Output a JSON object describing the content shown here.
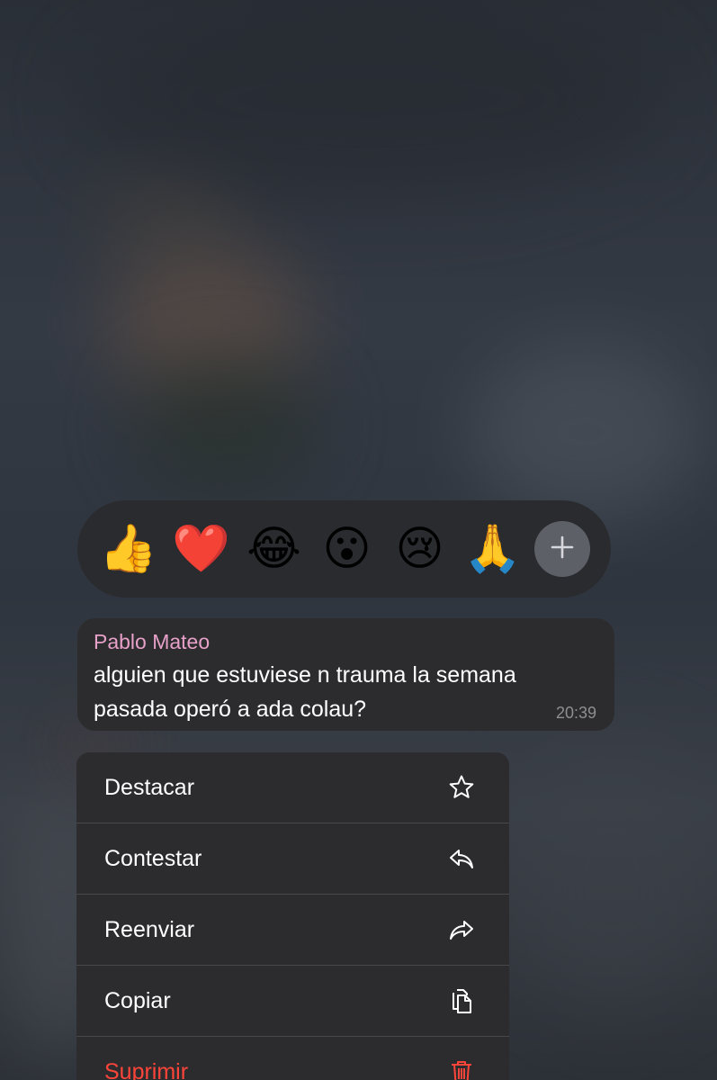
{
  "reactions": [
    {
      "emoji": "👍",
      "name": "thumbs-up"
    },
    {
      "emoji": "❤️",
      "name": "red-heart"
    },
    {
      "emoji": "😂",
      "name": "tears-of-joy"
    },
    {
      "emoji": "😮",
      "name": "surprised"
    },
    {
      "emoji": "😢",
      "name": "crying"
    },
    {
      "emoji": "🙏",
      "name": "folded-hands"
    }
  ],
  "plus_icon": "plus-icon",
  "message": {
    "sender": "Pablo Mateo",
    "text": "alguien que estuviese n trauma la semana pasada operó a ada colau?",
    "time": "20:39"
  },
  "menu": [
    {
      "label": "Destacar",
      "icon": "star-icon"
    },
    {
      "label": "Contestar",
      "icon": "reply-icon"
    },
    {
      "label": "Reenviar",
      "icon": "forward-icon"
    },
    {
      "label": "Copiar",
      "icon": "copy-icon"
    },
    {
      "label": "Suprimir",
      "icon": "trash-icon",
      "danger": true
    }
  ],
  "colors": {
    "sender": "#e7a1c9",
    "danger": "#ff453a",
    "surface": "#2c2c2e"
  }
}
